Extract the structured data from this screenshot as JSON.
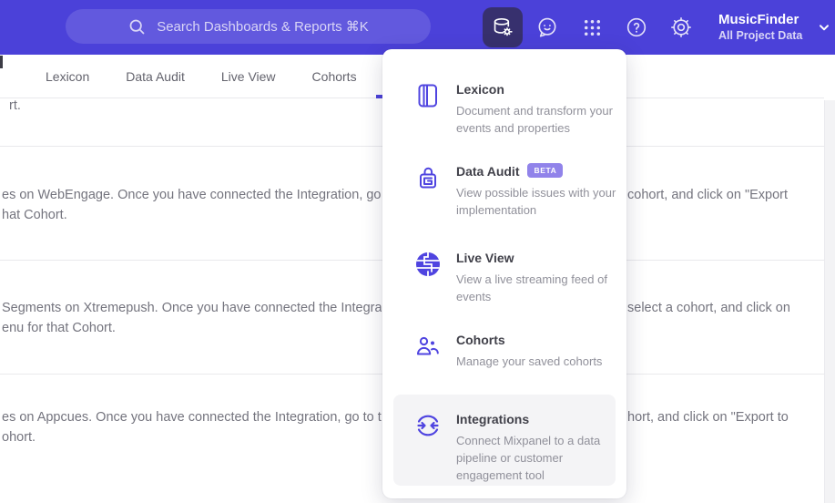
{
  "header": {
    "search_placeholder": "Search Dashboards & Reports ⌘K",
    "project_name": "MusicFinder",
    "project_subtitle": "All Project Data",
    "icon_names": [
      "search-icon",
      "data-management-icon",
      "feedback-chat-icon",
      "apps-grid-icon",
      "help-icon",
      "settings-gear-icon",
      "chevron-down-icon"
    ]
  },
  "tabs": [
    {
      "label": "Lexicon"
    },
    {
      "label": "Data Audit"
    },
    {
      "label": "Live View"
    },
    {
      "label": "Cohorts"
    }
  ],
  "menu": {
    "items": [
      {
        "title": "Lexicon",
        "description": "Document and transform your events and properties",
        "icon": "lexicon-book-icon"
      },
      {
        "title": "Data Audit",
        "badge": "BETA",
        "description": "View possible issues with your implementation",
        "icon": "data-audit-lock-icon"
      },
      {
        "title": "Live View",
        "description": "View a live streaming feed of events",
        "icon": "live-view-globe-icon"
      },
      {
        "title": "Cohorts",
        "description": "Manage your saved cohorts",
        "icon": "cohorts-people-icon"
      },
      {
        "title": "Integrations",
        "description": "Connect Mixpanel to a data pipeline or customer engagement tool",
        "icon": "integrations-sync-icon",
        "state": "hovered"
      }
    ]
  },
  "content": {
    "partial_line": "rt.",
    "rows": [
      {
        "left_line1": "es on WebEngage. Once you have connected the Integration, go to the",
        "right_line1": "cohort, and click on \"Export",
        "left_line2": "hat Cohort."
      },
      {
        "left_line1": "Segments on Xtremepush. Once you have connected the Integration, ",
        "right_line1": "select a cohort, and click on",
        "left_line2": "enu for that Cohort."
      },
      {
        "left_line1": "es on Appcues. Once you have connected the Integration, go to the M",
        "right_line1": "hort, and click on \"Export to",
        "left_line2": "ohort."
      }
    ]
  },
  "colors": {
    "header_bg": "#4b41d9",
    "accent": "#4f44e0",
    "active_icon_button_bg": "#37306e",
    "badge_bg": "#9183ea",
    "hover_item_bg": "#f4f4f6",
    "body_text": "#74747e",
    "divider": "#e9e9ec"
  }
}
